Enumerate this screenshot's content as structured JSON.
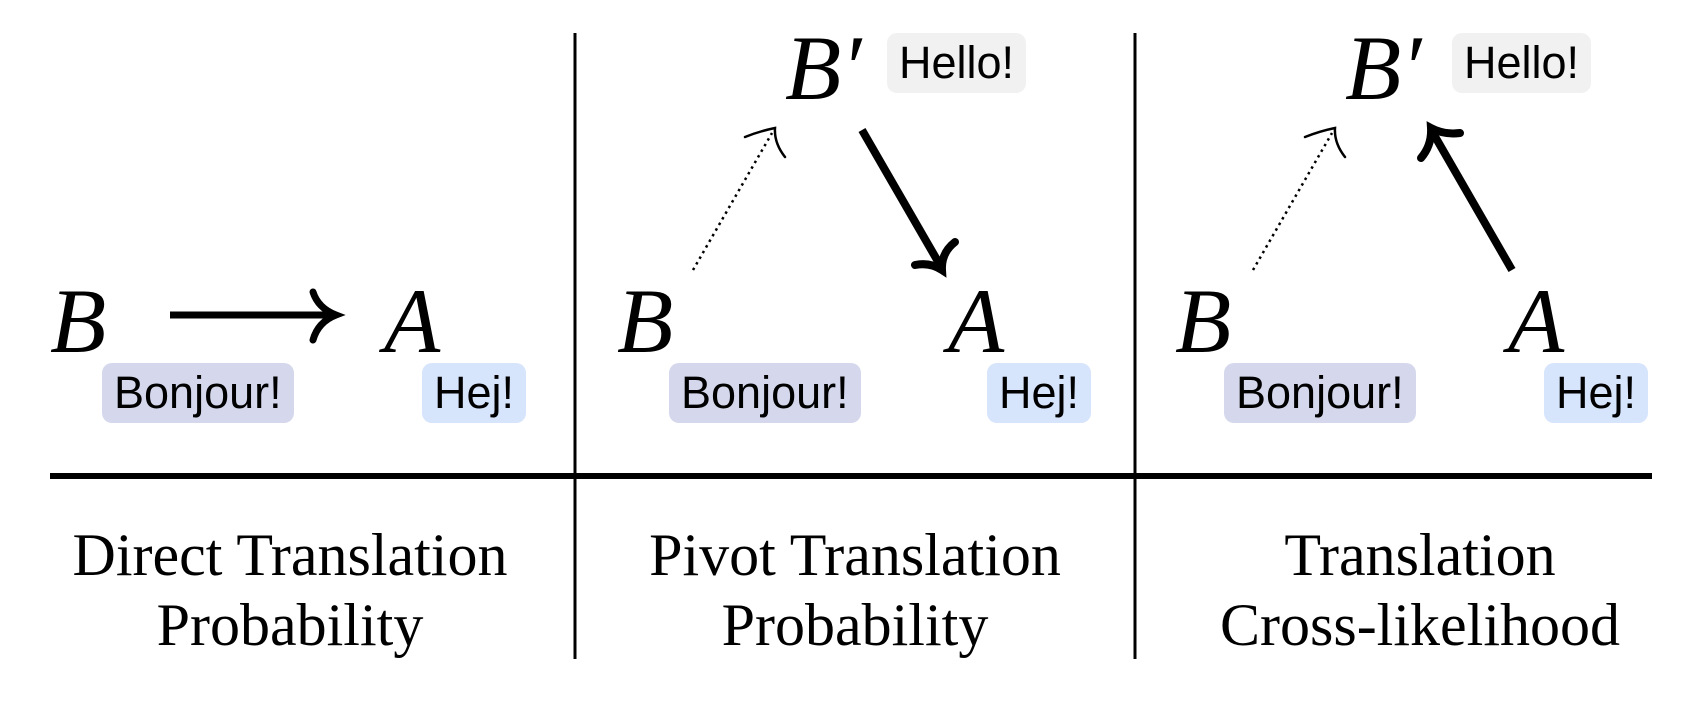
{
  "colors": {
    "source_chip": "#d5d8ec",
    "target_chip": "#d6e4fc",
    "pivot_chip": "#f1f1f1",
    "ink": "#000000"
  },
  "panels": [
    {
      "id": "direct",
      "nodes": {
        "source": {
          "symbol": "B",
          "label": "Bonjour!"
        },
        "target": {
          "symbol": "A",
          "label": "Hej!"
        }
      },
      "edges": [
        {
          "from": "B",
          "to": "A",
          "style": "solid-thick"
        }
      ],
      "caption": [
        "Direct Translation",
        "Probability"
      ]
    },
    {
      "id": "pivot",
      "nodes": {
        "source": {
          "symbol": "B",
          "label": "Bonjour!"
        },
        "pivot": {
          "symbol": "B′",
          "label": "Hello!"
        },
        "target": {
          "symbol": "A",
          "label": "Hej!"
        }
      },
      "edges": [
        {
          "from": "B",
          "to": "B′",
          "style": "dotted-thin"
        },
        {
          "from": "B′",
          "to": "A",
          "style": "solid-thick"
        }
      ],
      "caption": [
        "Pivot Translation",
        "Probability"
      ]
    },
    {
      "id": "cross-likelihood",
      "nodes": {
        "source": {
          "symbol": "B",
          "label": "Bonjour!"
        },
        "pivot": {
          "symbol": "B′",
          "label": "Hello!"
        },
        "target": {
          "symbol": "A",
          "label": "Hej!"
        }
      },
      "edges": [
        {
          "from": "B",
          "to": "B′",
          "style": "dotted-thin"
        },
        {
          "from": "A",
          "to": "B′",
          "style": "solid-thick"
        }
      ],
      "caption": [
        "Translation",
        "Cross-likelihood"
      ]
    }
  ]
}
